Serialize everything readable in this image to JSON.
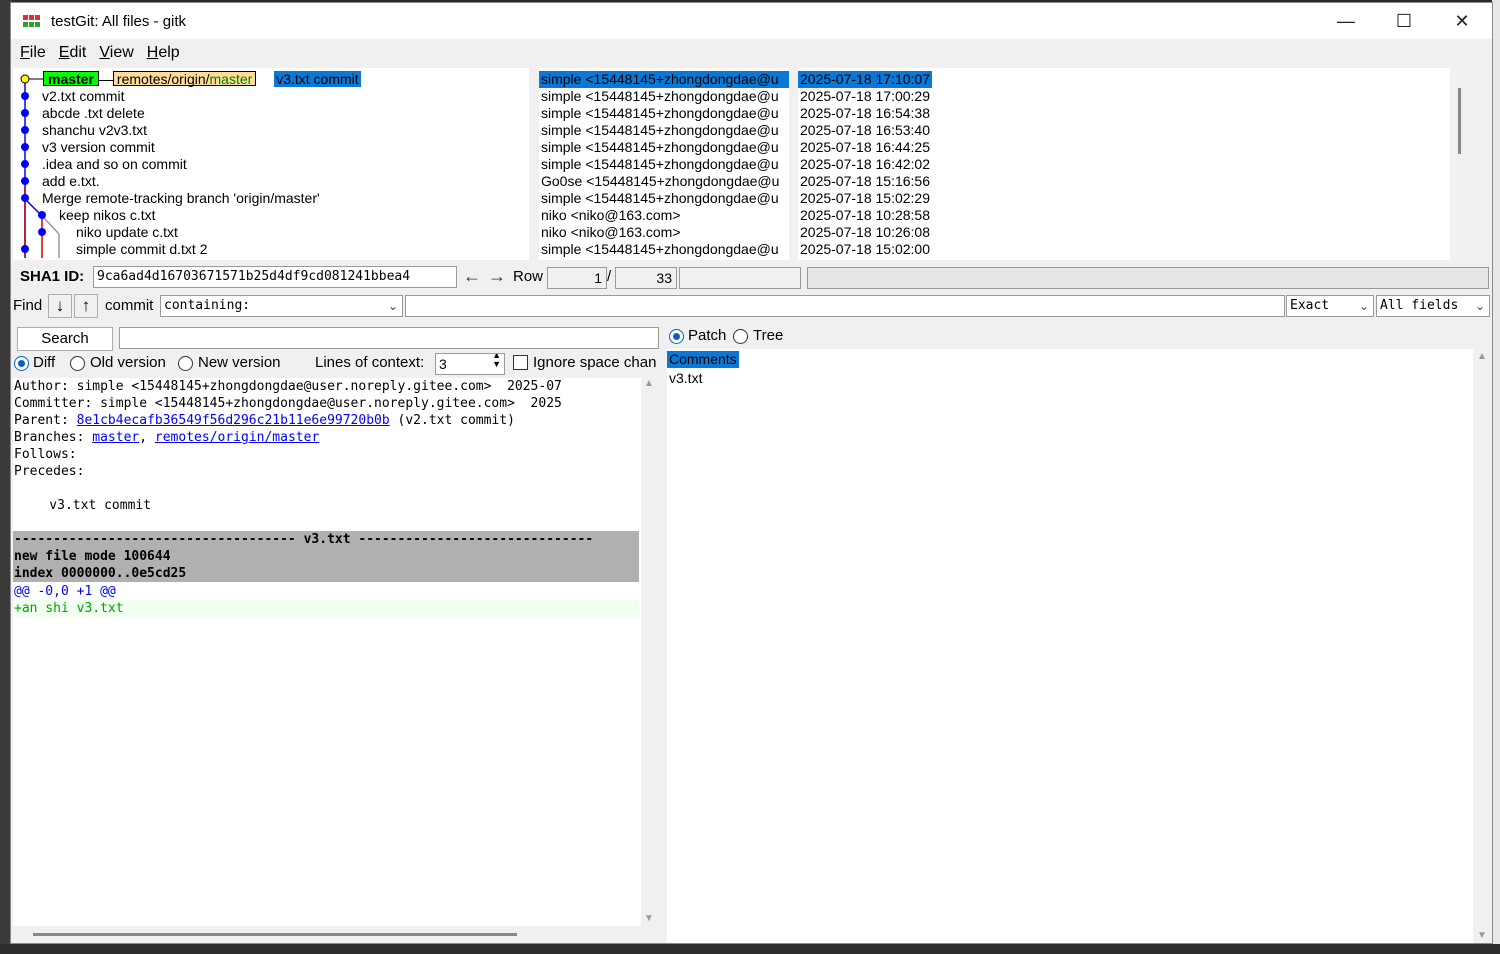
{
  "window": {
    "title": "testGit: All files - gitk",
    "controls": {
      "minimize": "—",
      "maximize": "☐",
      "close": "✕"
    }
  },
  "menu": [
    {
      "label": "File",
      "accel": "F",
      "rest": "ile"
    },
    {
      "label": "Edit",
      "accel": "E",
      "rest": "dit"
    },
    {
      "label": "View",
      "accel": "V",
      "rest": "iew"
    },
    {
      "label": "Help",
      "accel": "H",
      "rest": "elp"
    }
  ],
  "refs": {
    "head": "master",
    "remote_prefix": "remotes/origin/",
    "remote_branch": "master"
  },
  "commits": [
    {
      "subject": "v3.txt commit",
      "author": "simple <15448145+zhongdongdae@u",
      "date": "2025-07-18 17:10:07"
    },
    {
      "subject": "v2.txt commit",
      "author": "simple <15448145+zhongdongdae@u",
      "date": "2025-07-18 17:00:29"
    },
    {
      "subject": "abcde .txt delete",
      "author": "simple <15448145+zhongdongdae@u",
      "date": "2025-07-18 16:54:38"
    },
    {
      "subject": "shanchu v2v3.txt",
      "author": "simple <15448145+zhongdongdae@u",
      "date": "2025-07-18 16:53:40"
    },
    {
      "subject": "v3 version commit",
      "author": "simple <15448145+zhongdongdae@u",
      "date": "2025-07-18 16:44:25"
    },
    {
      "subject": ".idea and so on commit",
      "author": "simple <15448145+zhongdongdae@u",
      "date": "2025-07-18 16:42:02"
    },
    {
      "subject": "add e.txt.",
      "author": "Go0se <15448145+zhongdongdae@u",
      "date": "2025-07-18 15:16:56"
    },
    {
      "subject": "Merge remote-tracking branch 'origin/master'",
      "author": "simple <15448145+zhongdongdae@u",
      "date": "2025-07-18 15:02:29"
    },
    {
      "subject": "keep nikos c.txt",
      "author": "niko <niko@163.com>",
      "date": "2025-07-18 10:28:58"
    },
    {
      "subject": "niko update c.txt",
      "author": "niko <niko@163.com>",
      "date": "2025-07-18 10:26:08"
    },
    {
      "subject": "simple commit d.txt 2",
      "author": "simple <15448145+zhongdongdae@u",
      "date": "2025-07-18 15:02:00"
    }
  ],
  "sha": {
    "label": "SHA1 ID:",
    "value": "9ca6ad4d16703671571b25d4df9cd081241bbea4",
    "row_label": "Row",
    "row_current": "1",
    "row_sep": "/",
    "row_total": "33"
  },
  "find": {
    "label": "Find",
    "commit_label": "commit",
    "mode": "containing:",
    "match": "Exact",
    "scope": "All fields"
  },
  "search": {
    "button": "Search",
    "diff": "Diff",
    "old_version": "Old version",
    "new_version": "New version",
    "context_label": "Lines of context:",
    "context_value": "3",
    "ignore_space": "Ignore space chan"
  },
  "details": {
    "author_line": "Author: simple <15448145+zhongdongdae@user.noreply.gitee.com>  2025-07",
    "committer_line": "Committer: simple <15448145+zhongdongdae@user.noreply.gitee.com>  2025",
    "parent_label": "Parent: ",
    "parent_hash": "8e1cb4ecafb36549f56d296c21b11e6e99720b0b",
    "parent_subject": " (v2.txt commit)",
    "branches_label": "Branches: ",
    "branch_1": "master",
    "branch_sep": ", ",
    "branch_2": "remotes/origin/master",
    "follows": "Follows:",
    "precedes": "Precedes:",
    "message": "    v3.txt commit"
  },
  "diff": {
    "file_header": "------------------------------------ v3.txt ------------------------------",
    "mode_line": "new file mode 100644",
    "index_line": "index 0000000..0e5cd25",
    "hunk": "@@ -0,0 +1 @@",
    "added": "+an shi v3.txt"
  },
  "tree": {
    "patch": "Patch",
    "tree": "Tree",
    "comments": "Comments",
    "files": [
      "v3.txt"
    ]
  },
  "colors": {
    "selection": "#0a78d7",
    "head_tag": "#00ff00",
    "remote_tag": "#ffdd99",
    "graph_blue": "#0000ff",
    "graph_red": "#cc0000",
    "graph_green": "#00aa00",
    "diff_header_bg": "#b0b0b0",
    "hunk": "#0000ff",
    "added": "#00a000"
  }
}
